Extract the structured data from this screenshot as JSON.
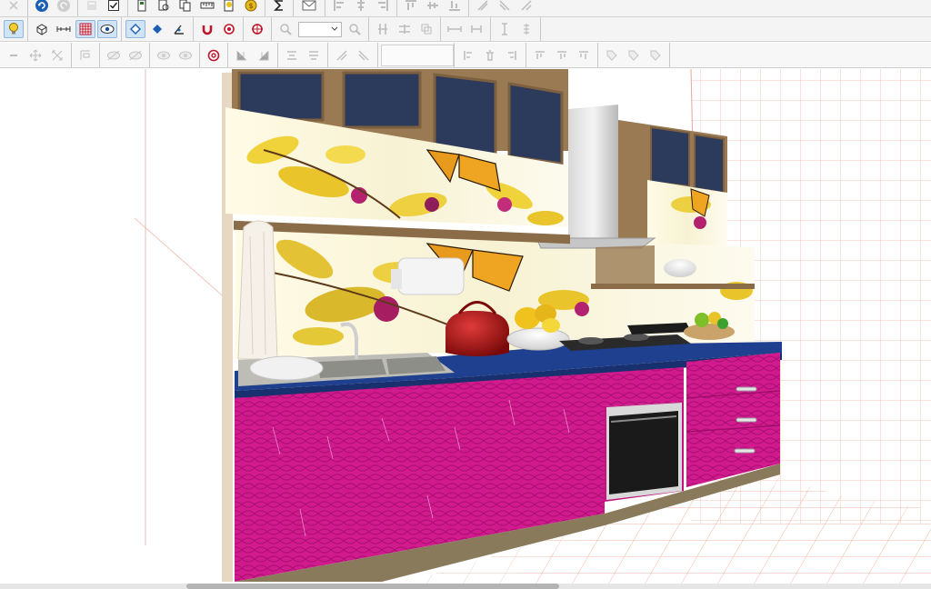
{
  "app": {
    "type": "3D kitchen design viewport"
  },
  "toolbars": {
    "row1_icons": [
      "undo-icon",
      "redo-icon",
      "checklist-icon",
      "sum-icon",
      "mail-icon"
    ],
    "row2_icons": [
      "bulb-icon",
      "grid-icon",
      "eye-icon",
      "zoom-icon",
      "target-icon"
    ],
    "zoom_value": "",
    "row3_icons": [
      "move-icon",
      "align-icon",
      "target-icon"
    ]
  },
  "colors": {
    "toolbar_bg": "#f4f4f4",
    "active_button": "#cfe4f7",
    "cabinet_magenta": "#d01a8e",
    "countertop_blue": "#1f3f8f",
    "cabinet_frame": "#9a7a52",
    "grid_line": "#f3b9a8"
  },
  "scene": {
    "objects": [
      "upper-cabinets",
      "backsplash-orchid-butterfly",
      "range-hood",
      "sink",
      "kettle",
      "fruit-bowl",
      "cooktop",
      "oven",
      "drawer-unit",
      "towel"
    ]
  }
}
